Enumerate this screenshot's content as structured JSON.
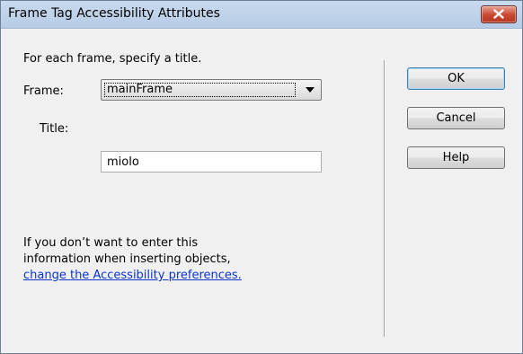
{
  "window": {
    "title": "Frame Tag Accessibility Attributes"
  },
  "form": {
    "instruction": "For each frame, specify a title.",
    "frame_label": "Frame:",
    "frame_value": "mainFrame",
    "title_label": "Title:",
    "title_value": "miolo"
  },
  "info": {
    "line1": "If you don’t want to enter this",
    "line2": "information when inserting objects,",
    "link": "change the Accessibility preferences."
  },
  "buttons": {
    "ok": "OK",
    "cancel": "Cancel",
    "help": "Help"
  },
  "icons": {
    "close": "close-icon",
    "dropdown": "chevron-down-icon"
  },
  "colors": {
    "titlebar": "#c9daee",
    "close_button": "#c7462e",
    "link": "#0b33cc",
    "dialog_bg": "#f0f0f0"
  }
}
